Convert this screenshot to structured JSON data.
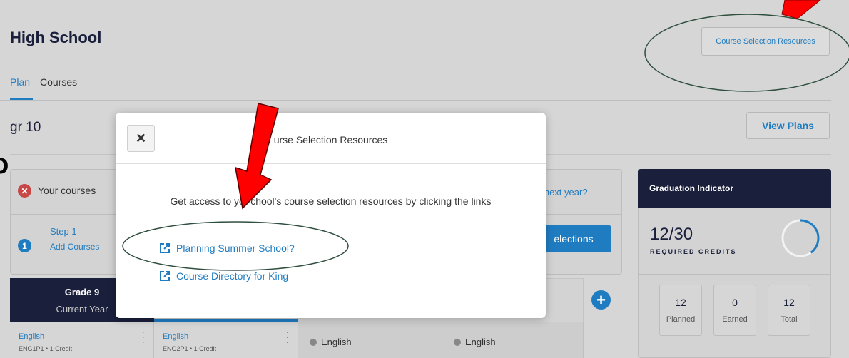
{
  "page": {
    "title": "High School"
  },
  "header": {
    "resources_button": "Course Selection Resources"
  },
  "tabs": [
    {
      "label": "Plan"
    },
    {
      "label": "Courses"
    }
  ],
  "plan": {
    "name": "gr 10",
    "view_plans": "View Plans"
  },
  "alert": {
    "text": "Your courses",
    "link": "g next year?"
  },
  "step": {
    "number": "1",
    "label": "Step 1",
    "link": "Add Courses",
    "button": "elections"
  },
  "edge_glyph": "o",
  "grade_columns": [
    {
      "grade": "Grade 9",
      "status": "Current Year"
    }
  ],
  "cells": [
    {
      "title": "English",
      "code": "ENG1P1 • 1 Credit"
    },
    {
      "title": "English",
      "code": "ENG2P1 • 1 Credit"
    },
    {
      "title": "English"
    },
    {
      "title": "English"
    }
  ],
  "graduation": {
    "header": "Graduation Indicator",
    "credits": "12/30",
    "credits_label": "REQUIRED CREDITS",
    "progress": 0.4,
    "stats": [
      {
        "value": "12",
        "label": "Planned"
      },
      {
        "value": "0",
        "label": "Earned"
      },
      {
        "value": "12",
        "label": "Total"
      }
    ]
  },
  "modal": {
    "title": "urse Selection Resources",
    "body": "Get access to yo   chool's course selection resources by clicking the links",
    "links": [
      {
        "label": "Planning Summer School?"
      },
      {
        "label": "Course Directory for King"
      }
    ]
  },
  "colors": {
    "accent": "#1f7cc1",
    "navy": "#1a1f3c",
    "annotation_arrow": "#ff0000"
  }
}
